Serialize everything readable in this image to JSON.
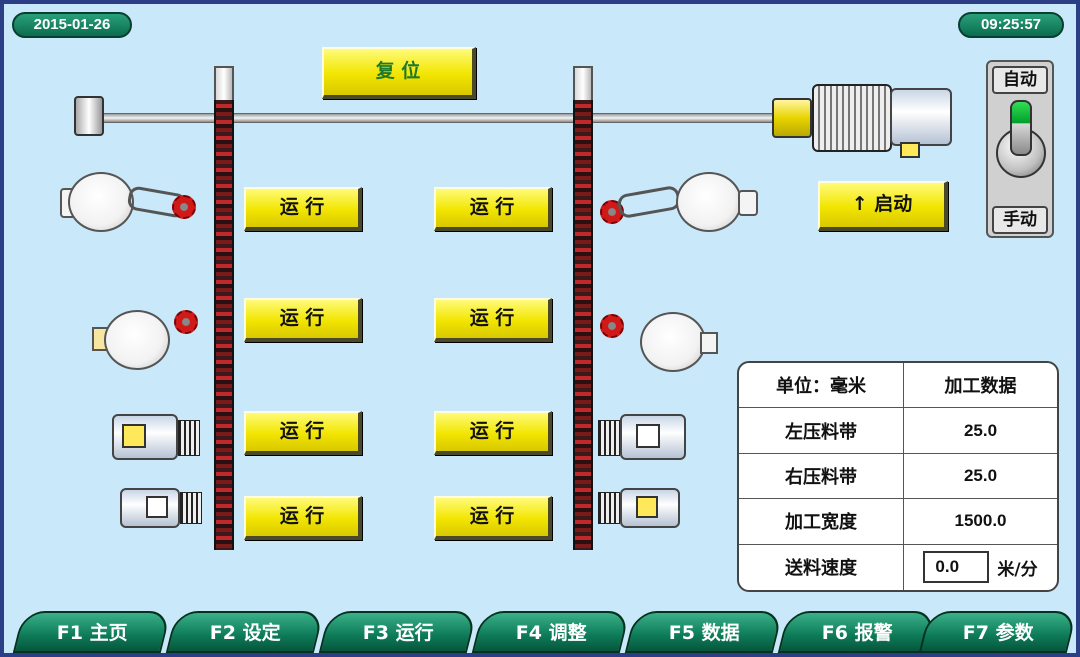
{
  "header": {
    "date": "2015-01-26",
    "time": "09:25:57"
  },
  "controls": {
    "reset_label": "复 位",
    "start_label": "↑ 启动",
    "run_labels": [
      "运 行",
      "运 行",
      "运 行",
      "运 行",
      "运 行",
      "运 行",
      "运 行",
      "运 行"
    ],
    "mode_auto": "自动",
    "mode_manual": "手动",
    "mode_state": "自动"
  },
  "data_table": {
    "header": {
      "col1": "单位：毫米",
      "col2": "加工数据"
    },
    "rows": [
      {
        "label": "左压料带",
        "value": "25.0"
      },
      {
        "label": "右压料带",
        "value": "25.0"
      },
      {
        "label": "加工宽度",
        "value": "1500.0"
      },
      {
        "label": "送料速度",
        "value": "0.0",
        "unit": "米/分"
      }
    ]
  },
  "tabs": [
    "F1 主页",
    "F2 设定",
    "F3 运行",
    "F4 调整",
    "F5 数据",
    "F6 报警",
    "F7 参数"
  ],
  "colors": {
    "background": "#c9e8f9",
    "button_yellow": "#f2e500",
    "tab_green": "#0d7a57",
    "frame": "#2c3e86"
  },
  "icons": [
    "top-shaft",
    "left-chain",
    "right-chain",
    "cutter-motor",
    "drive-motor",
    "gear-motor",
    "mode-switch-knob"
  ]
}
